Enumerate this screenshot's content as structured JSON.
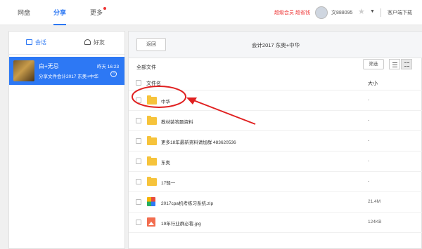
{
  "nav": {
    "netdisk": "网盘",
    "share": "分享",
    "more": "更多"
  },
  "header": {
    "vip_link": "超级会员 超省钱",
    "username": "文888095",
    "client_download": "客户端下载"
  },
  "left": {
    "tabs": {
      "session": "会话",
      "friends": "好友"
    },
    "conversation": {
      "name": "白+无忌",
      "time": "昨天 16:23",
      "message": "分享文件会计2017 东奥+中华"
    }
  },
  "right": {
    "back": "返回",
    "title": "会计2017 东奥+中华",
    "all_files": "全部文件",
    "filter": "筛选",
    "col_name": "文件名",
    "col_size": "大小",
    "files": [
      {
        "name": "中华",
        "size": "-",
        "type": "folder"
      },
      {
        "name": "教材装答题资料",
        "size": "-",
        "type": "folder"
      },
      {
        "name": "更多18年最新资料请加群 483620536",
        "size": "-",
        "type": "folder"
      },
      {
        "name": "东奥",
        "size": "-",
        "type": "folder"
      },
      {
        "name": "17轻一",
        "size": "-",
        "type": "folder"
      },
      {
        "name": "2017cpa机考练习系统.zip",
        "size": "21.4M",
        "type": "zip"
      },
      {
        "name": "19年行业群必看.jpg",
        "size": "124KB",
        "type": "image"
      }
    ]
  },
  "colors": {
    "accent": "#2d78f4",
    "annotation": "#e02020",
    "folder": "#f6c33b"
  }
}
